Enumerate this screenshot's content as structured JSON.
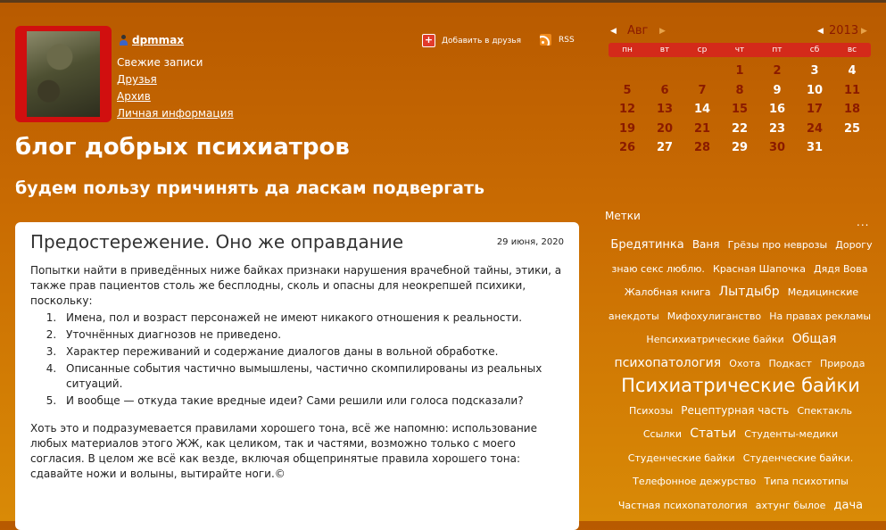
{
  "profile": {
    "username": "dpmmax",
    "nav": [
      {
        "label": "Свежие записи",
        "link": false
      },
      {
        "label": "Друзья",
        "link": true
      },
      {
        "label": "Архив",
        "link": true
      },
      {
        "label": "Личная информация",
        "link": true
      }
    ],
    "add_friends": "Добавить в друзья",
    "rss": "RSS"
  },
  "blog": {
    "title": "блог добрых психиатров",
    "subtitle": "будем пользу причинять да ласкам подвергать"
  },
  "post": {
    "title": "Предостережение. Оно же оправдание",
    "date": "29 июня, 2020",
    "intro": "Попытки найти в приведённых ниже байках признаки нарушения врачебной тайны, этики, а также прав пациентов столь же бесплодны, сколь и опасны для неокрепшей психики, поскольку:",
    "items": [
      "Имена, пол и возраст персонажей не имеют никакого отношения к реальности.",
      "Уточнённых диагнозов не приведено.",
      "Характер переживаний и содержание диалогов даны в вольной обработке.",
      "Описанные события частично вымышлены, частично скомпилированы из реальных ситуаций.",
      "И вообще — откуда такие вредные идеи? Сами решили или голоса подсказали?"
    ],
    "outro": "Хоть это и подразумевается правилами хорошего тона, всё же напомню: использование любых материалов этого ЖЖ, как целиком, так и частями, возможно только с моего согласия. В целом же всё как везде, включая общепринятые правила хорошего тона: сдавайте ножи и волыны, вытирайте ноги.©"
  },
  "calendar": {
    "month": "Авг",
    "year": "2013",
    "weekdays": [
      "пн",
      "вт",
      "ср",
      "чт",
      "пт",
      "сб",
      "вс"
    ],
    "weeks": [
      [
        "",
        "",
        "",
        "1",
        "2",
        "3",
        "4"
      ],
      [
        "5",
        "6",
        "7",
        "8",
        "9",
        "10",
        "11"
      ],
      [
        "12",
        "13",
        "14",
        "15",
        "16",
        "17",
        "18"
      ],
      [
        "19",
        "20",
        "21",
        "22",
        "23",
        "24",
        "25"
      ],
      [
        "26",
        "27",
        "28",
        "29",
        "30",
        "31",
        ""
      ]
    ],
    "white_days": [
      "3",
      "4",
      "9",
      "10",
      "14",
      "16",
      "22",
      "23",
      "25",
      "27",
      "29",
      "31"
    ],
    "colors": {
      "post_day": "#8a1a00",
      "empty_day": "#ffffff",
      "header": "#d42a1a"
    }
  },
  "tags": {
    "label": "Метки",
    "more": "...",
    "items": [
      {
        "text": "Бредятинка",
        "size": 13
      },
      {
        "text": "Ваня",
        "size": 12
      },
      {
        "text": "Грёзы про неврозы",
        "size": 11
      },
      {
        "text": "Дорогу знаю секс люблю.",
        "size": 11
      },
      {
        "text": "Красная Шапочка",
        "size": 11
      },
      {
        "text": "Дядя Вова",
        "size": 11
      },
      {
        "text": "Жалобная книга",
        "size": 11
      },
      {
        "text": "Лытдыбр",
        "size": 14
      },
      {
        "text": "Медицинские анекдоты",
        "size": 11
      },
      {
        "text": "Мифохулиганство",
        "size": 11
      },
      {
        "text": "На правах рекламы",
        "size": 11
      },
      {
        "text": "Непсихиатрические байки",
        "size": 11
      },
      {
        "text": "Общая психопатология",
        "size": 14
      },
      {
        "text": "Охота",
        "size": 11
      },
      {
        "text": "Подкаст",
        "size": 11
      },
      {
        "text": "Природа",
        "size": 11
      },
      {
        "text": "Психиатрические байки",
        "size": 21
      },
      {
        "text": "Психозы",
        "size": 11
      },
      {
        "text": "Рецептурная часть",
        "size": 12
      },
      {
        "text": "Спектакль",
        "size": 11
      },
      {
        "text": "Ссылки",
        "size": 11
      },
      {
        "text": "Статьи",
        "size": 14
      },
      {
        "text": "Студенты-медики",
        "size": 11
      },
      {
        "text": "Студенческие байки",
        "size": 11
      },
      {
        "text": "Студенческие байки.",
        "size": 11
      },
      {
        "text": "Телефонное дежурство",
        "size": 11
      },
      {
        "text": "Типа психотипы",
        "size": 11
      },
      {
        "text": "Частная психопатология",
        "size": 11
      },
      {
        "text": "ахтунг былое",
        "size": 11
      },
      {
        "text": "дача",
        "size": 13
      }
    ]
  }
}
